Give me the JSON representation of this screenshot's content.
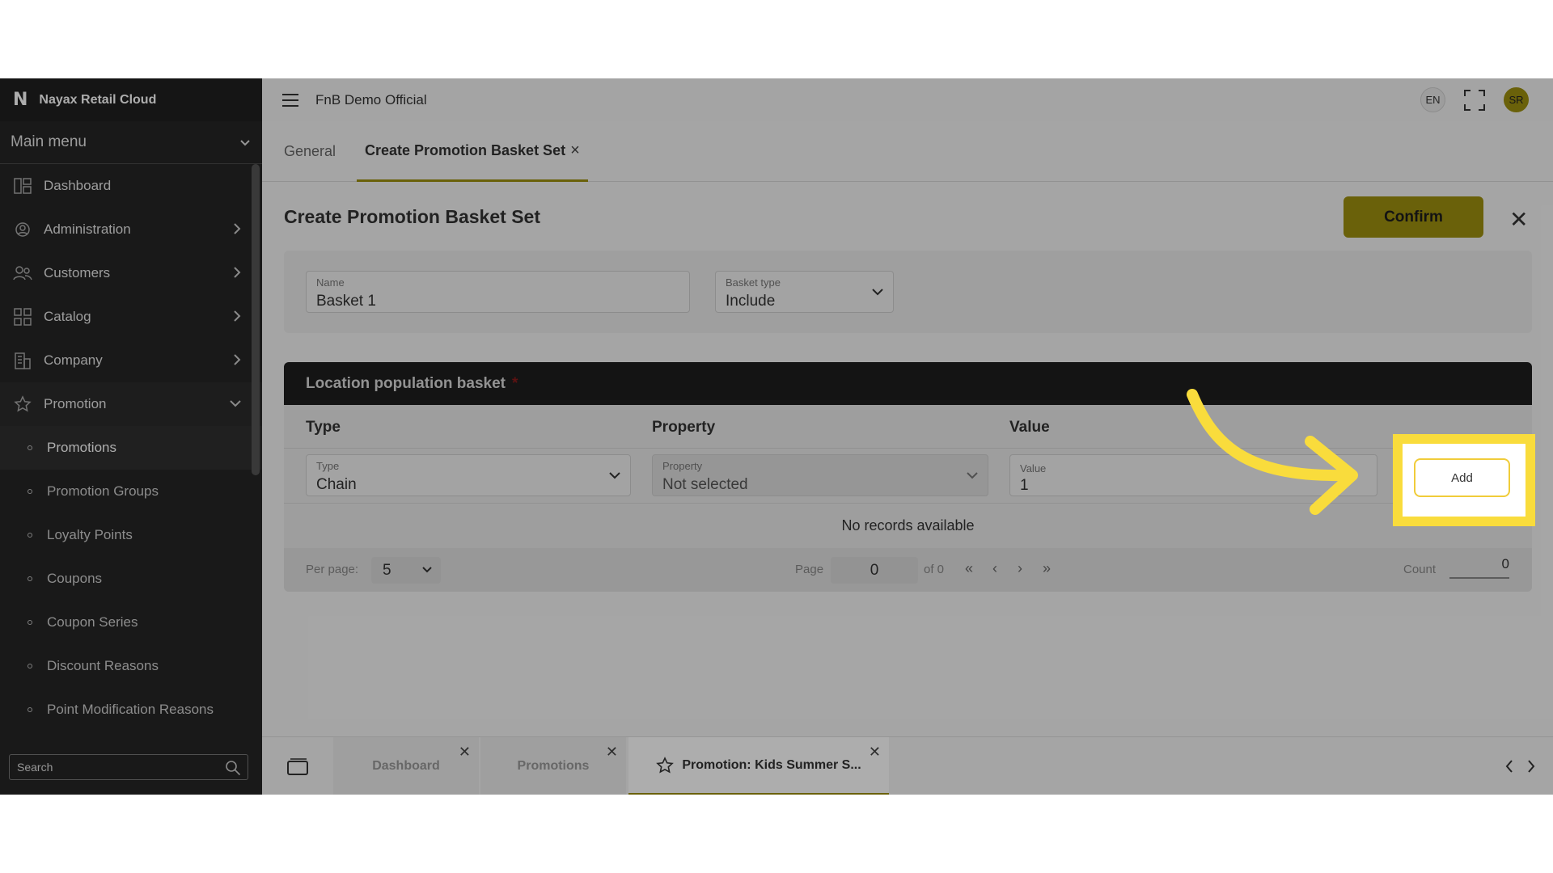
{
  "app": {
    "brand_logo": "N",
    "brand_title": "Nayax Retail Cloud",
    "org_name": "FnB Demo Official",
    "lang": "EN",
    "user_initials": "SR"
  },
  "sidebar": {
    "main_menu": "Main menu",
    "items": [
      {
        "label": "Dashboard",
        "icon": "dashboard-icon"
      },
      {
        "label": "Administration",
        "icon": "administration-icon"
      },
      {
        "label": "Customers",
        "icon": "customers-icon"
      },
      {
        "label": "Catalog",
        "icon": "catalog-icon"
      },
      {
        "label": "Company",
        "icon": "company-icon"
      },
      {
        "label": "Promotion",
        "icon": "star-icon"
      }
    ],
    "sub_items": [
      "Promotions",
      "Promotion Groups",
      "Loyalty Points",
      "Coupons",
      "Coupon Series",
      "Discount Reasons",
      "Point Modification Reasons"
    ],
    "search_placeholder": "Search"
  },
  "tabs": {
    "general": "General",
    "create": "Create Promotion Basket Set",
    "close_glyph": "×"
  },
  "page": {
    "title": "Create Promotion Basket Set",
    "confirm": "Confirm",
    "close_glyph": "✕",
    "name_label": "Name",
    "name_value": "Basket 1",
    "basket_type_label": "Basket type",
    "basket_type_value": "Include"
  },
  "location": {
    "header": "Location population basket",
    "required_mark": "*",
    "columns": [
      "Type",
      "Property",
      "Value"
    ],
    "type_label": "Type",
    "type_value": "Chain",
    "property_label": "Property",
    "property_value": "Not selected",
    "value_label": "Value",
    "value_value": "1",
    "add_button": "Add",
    "no_records": "No records available",
    "per_page_label": "Per page:",
    "per_page_value": "5",
    "page_label": "Page",
    "page_value": "0",
    "of_label": "of 0",
    "count_label": "Count",
    "count_value": "0"
  },
  "bottom_tabs": [
    {
      "label": "Dashboard"
    },
    {
      "label": "Promotions"
    },
    {
      "label": "Promotion: Kids Summer S..."
    }
  ],
  "colors": {
    "accent": "#9d8f10",
    "highlight": "#f9dc3c",
    "sidebar_bg": "#262626"
  }
}
